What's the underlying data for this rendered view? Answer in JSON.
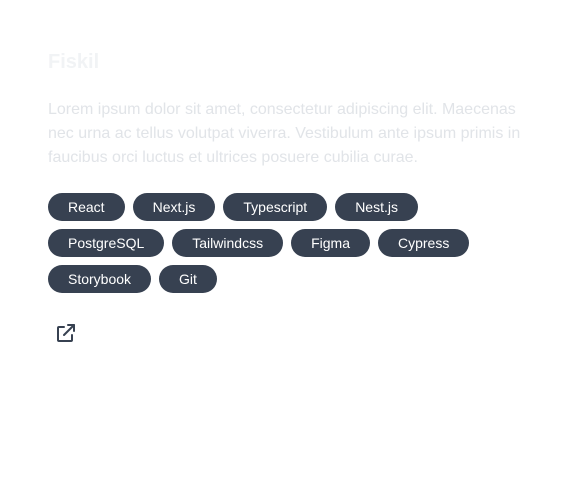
{
  "project": {
    "title": "Fiskil",
    "description": "Lorem ipsum dolor sit amet, consectetur adipiscing elit. Maecenas nec urna ac tellus volutpat viverra. Vestibulum ante ipsum primis in faucibus orci luctus et ultrices posuere cubilia curae.",
    "tags": [
      "React",
      "Next.js",
      "Typescript",
      "Nest.js",
      "PostgreSQL",
      "Tailwindcss",
      "Figma",
      "Cypress",
      "Storybook",
      "Git"
    ],
    "link_icon": "external-link-icon"
  },
  "colors": {
    "tag_background": "#374151",
    "tag_text": "#ffffff",
    "icon": "#374151"
  }
}
